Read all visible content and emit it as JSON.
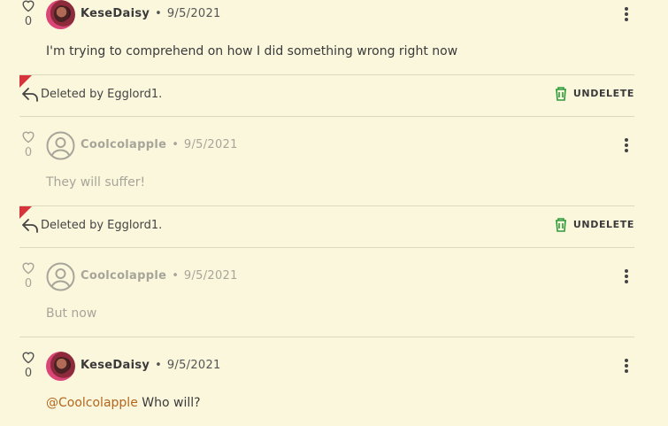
{
  "comments": [
    {
      "username": "KeseDaisy",
      "date": "9/5/2021",
      "likes": "0",
      "body": "I'm trying to comprehend on how I did something wrong right now",
      "avatar": "photo",
      "dim": false
    },
    {
      "username": "Coolcolapple",
      "date": "9/5/2021",
      "likes": "0",
      "body": "They will suffer!",
      "avatar": "generic-user-icon",
      "dim": true
    },
    {
      "username": "Coolcolapple",
      "date": "9/5/2021",
      "likes": "0",
      "body": "But now",
      "avatar": "generic-user-icon",
      "dim": true
    },
    {
      "username": "KeseDaisy",
      "date": "9/5/2021",
      "likes": "0",
      "mention": "@Coolcolapple",
      "body": " Who will?",
      "avatar": "photo",
      "dim": false
    }
  ],
  "deleted_bars": [
    {
      "text": "Deleted by Egglord1.",
      "action": "UNDELETE"
    },
    {
      "text": "Deleted by Egglord1.",
      "action": "UNDELETE"
    }
  ],
  "separator": "•",
  "colors": {
    "background": "#fbf7dc",
    "flag": "#d6333b",
    "undelete_icon": "#2e9b3a",
    "mention": "#b3661e"
  }
}
